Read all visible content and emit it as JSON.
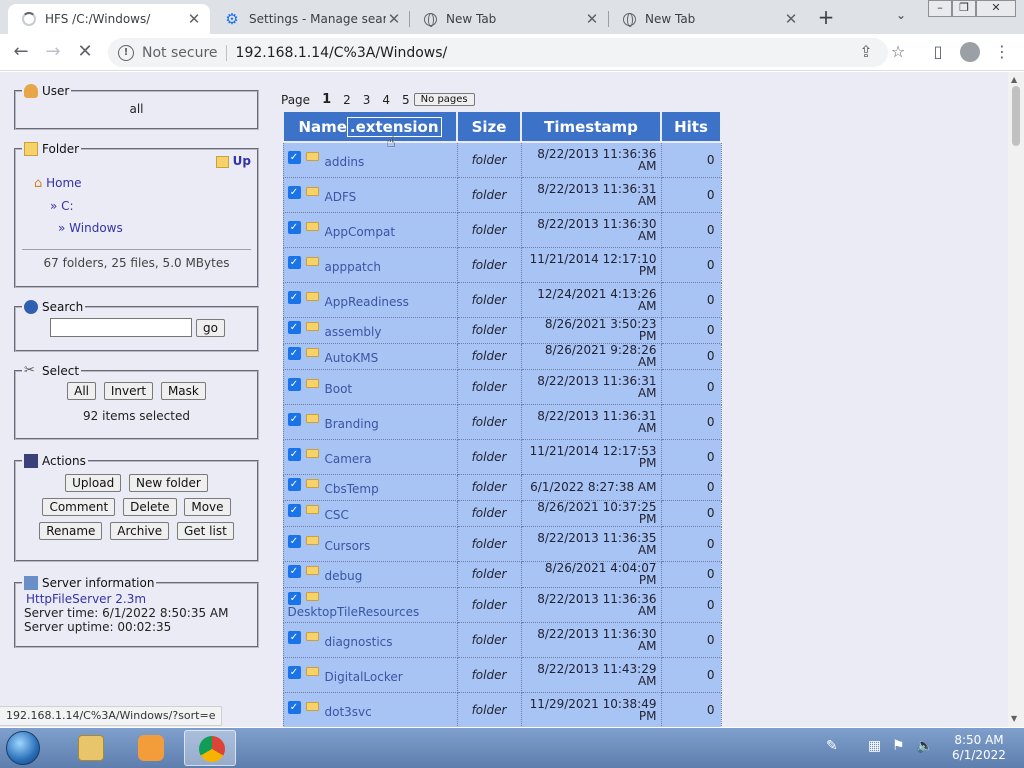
{
  "browser": {
    "tabs": [
      {
        "title": "HFS /C:/Windows/",
        "icon": "loading-spinner"
      },
      {
        "title": "Settings - Manage search",
        "icon": "gear-icon"
      },
      {
        "title": "New Tab",
        "icon": "globe-icon"
      },
      {
        "title": "New Tab",
        "icon": "globe-icon"
      }
    ],
    "not_secure": "Not secure",
    "url": "192.168.1.14/C%3A/Windows/"
  },
  "sidebar": {
    "user": {
      "legend": "User",
      "value": "all"
    },
    "folder": {
      "legend": "Folder",
      "up": "Up",
      "home": "Home",
      "path": [
        "» C:",
        "» Windows"
      ],
      "summary": "67 folders, 25 files, 5.0 MBytes"
    },
    "search": {
      "legend": "Search",
      "placeholder": "",
      "go": "go"
    },
    "select": {
      "legend": "Select",
      "buttons": [
        "All",
        "Invert",
        "Mask"
      ],
      "status": "92 items selected"
    },
    "actions": {
      "legend": "Actions",
      "buttons": [
        "Upload",
        "New folder",
        "Comment",
        "Delete",
        "Move",
        "Rename",
        "Archive",
        "Get list"
      ]
    },
    "server": {
      "legend": "Server information",
      "product": "HttpFileServer 2.3m",
      "time": "Server time: 6/1/2022 8:50:35 AM",
      "uptime": "Server uptime: 00:02:35"
    }
  },
  "pager": {
    "label": "Page",
    "pages": [
      "1",
      "2",
      "3",
      "4",
      "5"
    ],
    "current": "1",
    "no_pages": "No pages"
  },
  "table": {
    "headers": {
      "name": "Name",
      "ext": ".extension",
      "size": "Size",
      "timestamp": "Timestamp",
      "hits": "Hits"
    },
    "rows": [
      {
        "name": "addins",
        "size": "folder",
        "ts": [
          "8/22/2013 11:36:36",
          "AM"
        ],
        "hits": "0"
      },
      {
        "name": "ADFS",
        "size": "folder",
        "ts": [
          "8/22/2013 11:36:31",
          "AM"
        ],
        "hits": "0"
      },
      {
        "name": "AppCompat",
        "size": "folder",
        "ts": [
          "8/22/2013 11:36:30",
          "AM"
        ],
        "hits": "0"
      },
      {
        "name": "apppatch",
        "size": "folder",
        "ts": [
          "11/21/2014 12:17:10",
          "PM"
        ],
        "hits": "0"
      },
      {
        "name": "AppReadiness",
        "size": "folder",
        "ts": [
          "12/24/2021 4:13:26",
          "AM"
        ],
        "hits": "0"
      },
      {
        "name": "assembly",
        "size": "folder",
        "ts": [
          "8/26/2021 3:50:23 PM"
        ],
        "hits": "0"
      },
      {
        "name": "AutoKMS",
        "size": "folder",
        "ts": [
          "8/26/2021 9:28:26 AM"
        ],
        "hits": "0"
      },
      {
        "name": "Boot",
        "size": "folder",
        "ts": [
          "8/22/2013 11:36:31",
          "AM"
        ],
        "hits": "0"
      },
      {
        "name": "Branding",
        "size": "folder",
        "ts": [
          "8/22/2013 11:36:31",
          "AM"
        ],
        "hits": "0"
      },
      {
        "name": "Camera",
        "size": "folder",
        "ts": [
          "11/21/2014 12:17:53",
          "PM"
        ],
        "hits": "0"
      },
      {
        "name": "CbsTemp",
        "size": "folder",
        "ts": [
          "6/1/2022 8:27:38 AM"
        ],
        "hits": "0"
      },
      {
        "name": "CSC",
        "size": "folder",
        "ts": [
          "8/26/2021 10:37:25 PM"
        ],
        "hits": "0"
      },
      {
        "name": "Cursors",
        "size": "folder",
        "ts": [
          "8/22/2013 11:36:35",
          "AM"
        ],
        "hits": "0"
      },
      {
        "name": "debug",
        "size": "folder",
        "ts": [
          "8/26/2021 4:04:07 PM"
        ],
        "hits": "0"
      },
      {
        "name": "DesktopTileResources",
        "size": "folder",
        "ts": [
          "8/22/2013 11:36:36",
          "AM"
        ],
        "hits": "0",
        "wrap": true
      },
      {
        "name": "diagnostics",
        "size": "folder",
        "ts": [
          "8/22/2013 11:36:30",
          "AM"
        ],
        "hits": "0"
      },
      {
        "name": "DigitalLocker",
        "size": "folder",
        "ts": [
          "8/22/2013 11:43:29",
          "AM"
        ],
        "hits": "0"
      },
      {
        "name": "dot3svc",
        "size": "folder",
        "ts": [
          "11/29/2021 10:38:49",
          "PM"
        ],
        "hits": "0"
      }
    ]
  },
  "status_link": "192.168.1.14/C%3A/Windows/?sort=e",
  "clock": {
    "time": "8:50 AM",
    "date": "6/1/2022"
  },
  "colors": {
    "header_blue": "#3c73c8",
    "row_blue": "#a8c4f4",
    "page_bg": "#ebebf5"
  }
}
